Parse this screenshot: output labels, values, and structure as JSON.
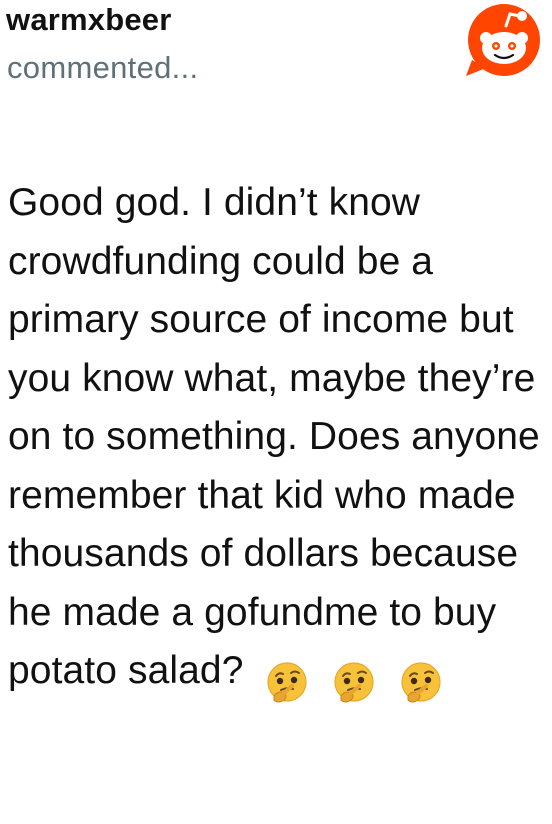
{
  "comment": {
    "username": "warmxbeer",
    "action": "commented...",
    "text": "Good god. I didn’t know crowdfunding could be a primary source of income but you know what, maybe they’re on to something. Does anyone remember that kid who made thousands of dollars because he made a gofundme to buy potato salad?",
    "emojis": [
      "thinking-face-icon",
      "thinking-face-icon",
      "thinking-face-icon"
    ]
  },
  "branding": {
    "logo": "reddit-snoo-icon",
    "accent_color": "#FF4500"
  }
}
